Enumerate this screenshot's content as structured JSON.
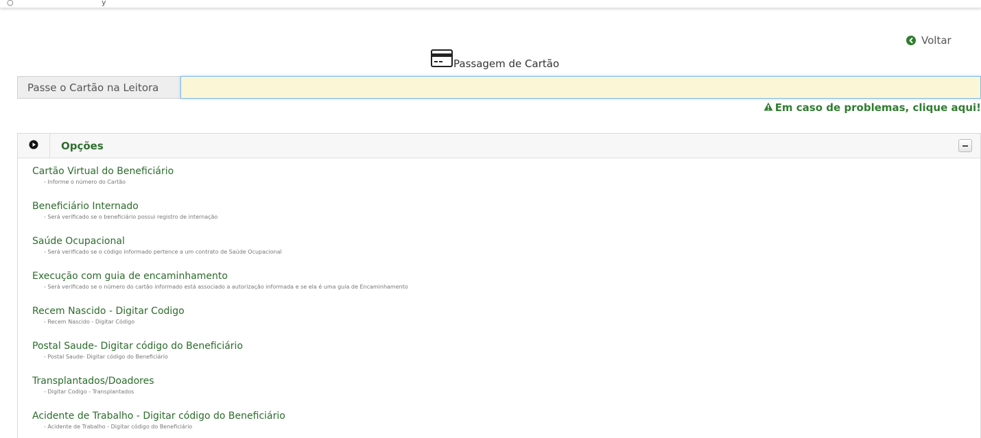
{
  "header": {
    "fragment": "y"
  },
  "back": {
    "label": "Voltar",
    "icon": "circle-arrow-left-icon"
  },
  "card_section": {
    "title": "Passagem de Cartão",
    "icon": "credit-card-icon",
    "addon_label": "Passe o Cartão na Leitora",
    "input_value": "",
    "input_bg_color": "#fbf7d6"
  },
  "help": {
    "label": "Em caso de problemas, clique aqui!",
    "icon": "warning-icon",
    "color": "#2f7d2f"
  },
  "options_panel": {
    "title": "Opções",
    "toggle_icon": "play-circle-icon",
    "collapse_icon": "minus-icon",
    "items": [
      {
        "title": "Cartão Virtual do Beneficiário",
        "desc": "- Informe o número do Cartão"
      },
      {
        "title": "Beneficiário Internado",
        "desc": "- Será verificado se o beneficiário possui registro de internação"
      },
      {
        "title": "Saúde Ocupacional",
        "desc": "- Será verificado se o código informado pertence a um contrato de Saúde Ocupacional"
      },
      {
        "title": "Execução com guia de encaminhamento",
        "desc": "- Será verificado se o número do cartão informado está associado a autorização informada e se ela é uma guia de Encaminhamento"
      },
      {
        "title": "Recem Nascido - Digitar Codigo",
        "desc": "- Recem Nascido - Digitar Código"
      },
      {
        "title": "Postal Saude- Digitar código do Beneficiário",
        "desc": "- Postal Saude- Digitar código do Beneficiário"
      },
      {
        "title": "Transplantados/Doadores",
        "desc": "- Digitar Codigo - Transplantados"
      },
      {
        "title": "Acidente de Trabalho - Digitar código do Beneficiário",
        "desc": "- Acidente de Trabalho - Digitar código do Beneficiário"
      }
    ]
  }
}
